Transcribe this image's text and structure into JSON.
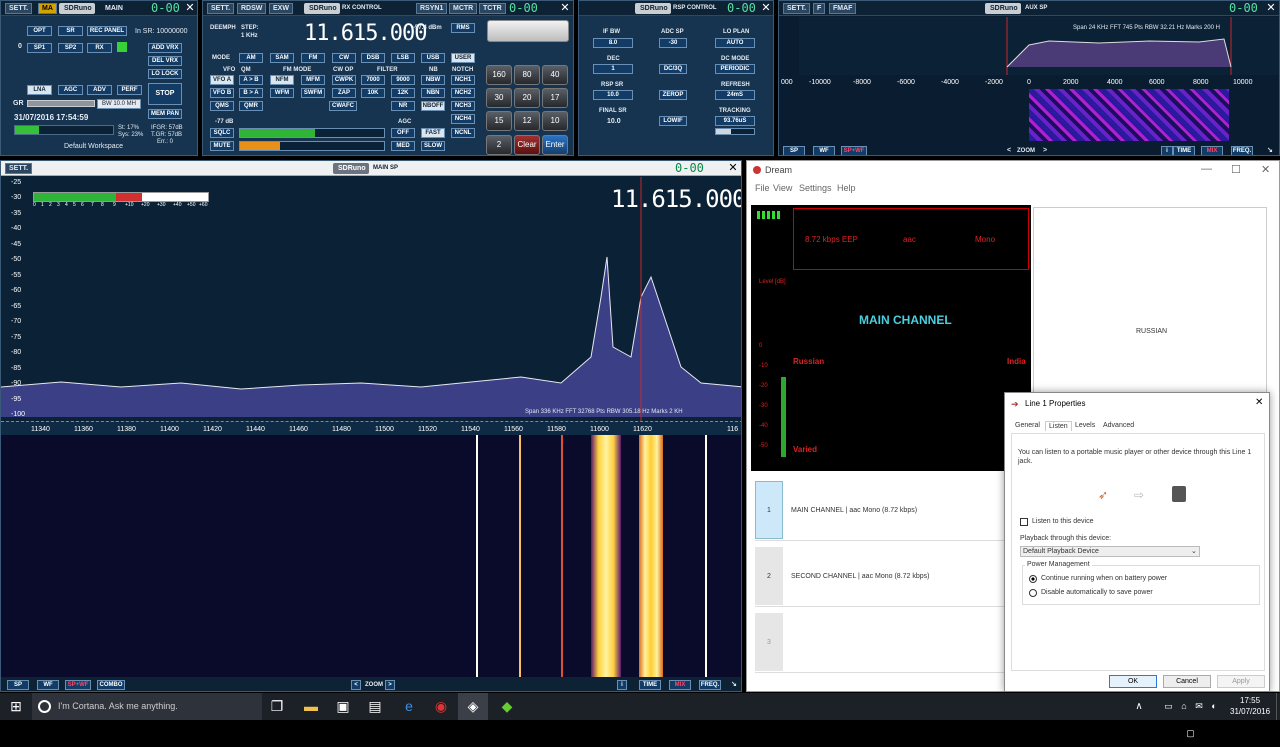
{
  "main": {
    "logo": "SDRuno",
    "title": "MAIN",
    "sett": "SETT.",
    "ma": "MA",
    "in_sr": "In SR: 10000000",
    "opt": "OPT",
    "sr": "SR",
    "rec_panel": "REC PANEL",
    "rx_num": "0",
    "sp1": "SP1",
    "sp2": "SP2",
    "rx": "RX",
    "add_vrx": "ADD VRX",
    "del_vrx": "DEL VRX",
    "lo_lock": "LO LOCK",
    "lna": "LNA",
    "agc": "AGC",
    "adv": "ADV",
    "perf": "PERF",
    "stop": "STOP",
    "mem_pan": "MEM PAN",
    "gr": "GR",
    "bw": "BW 10.0 MH",
    "datetime": "31/07/2016 17:54:59",
    "st": "St: 17%",
    "sys": "Sys: 23%",
    "ifgr": "IFGR: 57dB",
    "tgr": "T.GR: 57dB",
    "err": "Err.: 0",
    "workspace": "Default Workspace",
    "counter": "0-00"
  },
  "rxc": {
    "logo": "SDRuno",
    "title": "RX CONTROL",
    "sett": "SETT.",
    "rdsw": "RDSW",
    "exw": "EXW",
    "rsyn": "RSYN1",
    "mctr": "MCTR",
    "tctr": "TCTR",
    "counter": "0-00",
    "deemph": "DEEMPH",
    "step": "STEP:",
    "step_val": "1 KHz",
    "freq": "11.615.000",
    "dbm": "-57.4 dBm",
    "rms": "RMS",
    "user": "USER",
    "mode_lbl": "MODE",
    "modes": [
      "AM",
      "SAM",
      "FM",
      "CW",
      "DSB",
      "LSB",
      "USB"
    ],
    "vfo_lbl": "VFO",
    "qm_lbl": "QM",
    "fm_mode_lbl": "FM MODE",
    "cw_op_lbl": "CW OP",
    "filter_lbl": "FILTER",
    "nb_lbl": "NB",
    "notch_lbl": "NOTCH",
    "vfoa": "VFO A",
    "ab": "A > B",
    "nfm": "NFM",
    "mfm": "MFM",
    "cwpk": "CWPK",
    "f7000": "7000",
    "f9000": "9000",
    "nbw": "NBW",
    "nch1": "NCH1",
    "vfob": "VFO B",
    "ba": "B > A",
    "wfm": "WFM",
    "swfm": "SWFM",
    "zap": "ZAP",
    "f10k": "10K",
    "f12k": "12K",
    "nbn": "NBN",
    "nch2": "NCH2",
    "qms": "QMS",
    "qmr": "QMR",
    "cwafc": "CWAFC",
    "nr": "NR",
    "nboff": "NBOFF",
    "nch3": "NCH3",
    "sq_db": "-77 dB",
    "agc_lbl": "AGC",
    "nch4": "NCH4",
    "sqlc": "SQLC",
    "off": "OFF",
    "fast": "FAST",
    "ncnl": "NCNL",
    "mute": "MUTE",
    "med": "MED",
    "slow": "SLOW",
    "keys": [
      "160",
      "80",
      "40",
      "30",
      "20",
      "17",
      "15",
      "12",
      "10",
      "2",
      "Clear",
      "Enter"
    ]
  },
  "rsp": {
    "logo": "SDRuno",
    "title": "RSP CONTROL",
    "counter": "0-00",
    "if_bw": "IF BW",
    "if_bw_val": "8.0",
    "adc_sp": "ADC SP",
    "adc_sp_val": "-30",
    "lo_plan": "LO PLAN",
    "lo_plan_val": "AUTO",
    "dec": "DEC",
    "dec_val": "1",
    "dcoq": "DC/3Q",
    "dc_mode": "DC MODE",
    "dc_mode_val": "PERIODIC",
    "rsp_sr": "RSP SR",
    "rsp_sr_val": "10.0",
    "zerop": "ZEROP",
    "refresh": "REFRESH",
    "refresh_val": "24mS",
    "final_sr": "FINAL SR",
    "final_sr_val": "10.0",
    "lowif": "LOWIF",
    "tracking": "TRACKING",
    "tracking_val": "93.76uS"
  },
  "aux": {
    "logo": "SDRuno",
    "title": "AUX SP",
    "sett": "SETT.",
    "f": "F",
    "fmaf": "FMAF",
    "counter": "0-00",
    "info": "Span 24 KHz  FFT 745 Pts  RBW 32.21 Hz  Marks 200 H",
    "ticks": [
      "000",
      "-10000",
      "-8000",
      "-6000",
      "-4000",
      "-2000",
      "0",
      "2000",
      "4000",
      "6000",
      "8000",
      "10000"
    ],
    "sp": "SP",
    "wf": "WF",
    "spwf": "SP+WF",
    "zoom": "ZOOM",
    "time": "TIME",
    "mix": "MIX",
    "freq": "FREQ."
  },
  "mainsp": {
    "logo": "SDRuno",
    "title": "MAIN SP",
    "sett": "SETT.",
    "counter": "0-00",
    "freq": "11.615.000",
    "yticks": [
      "-25",
      "-30",
      "-35",
      "-40",
      "-45",
      "-50",
      "-55",
      "-60",
      "-65",
      "-70",
      "-75",
      "-80",
      "-85",
      "-90",
      "-95",
      "-100"
    ],
    "smeter": [
      "0",
      "1",
      "2",
      "3",
      "4",
      "5",
      "6",
      "7",
      "8",
      "9",
      "+10",
      "+20",
      "+30",
      "+40",
      "+50",
      "+60"
    ],
    "info": "Span 336 KHz  FFT 32768 Pts  RBW 305.18 Hz  Marks 2 KH",
    "xticks": [
      "11340",
      "11360",
      "11380",
      "11400",
      "11420",
      "11440",
      "11460",
      "11480",
      "11500",
      "11520",
      "11540",
      "11560",
      "11580",
      "11600",
      "11620",
      "116"
    ],
    "sp": "SP",
    "wf": "WF",
    "spwf": "SP+WF",
    "combo": "COMBO",
    "zoom": "ZOOM",
    "time": "TIME",
    "mix": "MIX",
    "freqb": "FREQ."
  },
  "dream": {
    "title": "Dream",
    "menu": [
      "File",
      "View",
      "Settings",
      "Help"
    ],
    "bitrate": "8.72 kbps EEP",
    "codec": "aac",
    "audio": "Mono",
    "main_channel": "MAIN CHANNEL",
    "language": "RUSSIAN",
    "level": "Level [dB]",
    "lang1": "Russian",
    "country": "India",
    "prog": "Varied",
    "levels": [
      "0",
      "-10",
      "-20",
      "-30",
      "-40",
      "-50"
    ],
    "services": [
      {
        "num": "1",
        "label": "MAIN CHANNEL  |  aac Mono (8.72 kbps)"
      },
      {
        "num": "2",
        "label": "SECOND CHANNEL  |  aac Mono (8.72 kbps)"
      },
      {
        "num": "3",
        "label": ""
      }
    ]
  },
  "props": {
    "title": "Line 1 Properties",
    "tabs": [
      "General",
      "Listen",
      "Levels",
      "Advanced"
    ],
    "desc": "You can listen to a portable music player or other device through this Line 1 jack.",
    "listen": "Listen to this device",
    "playback": "Playback through this device:",
    "device": "Default Playback Device",
    "power": "Power Management",
    "opt1": "Continue running when on battery power",
    "opt2": "Disable automatically to save power",
    "ok": "OK",
    "cancel": "Cancel",
    "apply": "Apply"
  },
  "taskbar": {
    "cortana": "I'm Cortana. Ask me anything.",
    "time": "17:55",
    "date": "31/07/2016"
  }
}
